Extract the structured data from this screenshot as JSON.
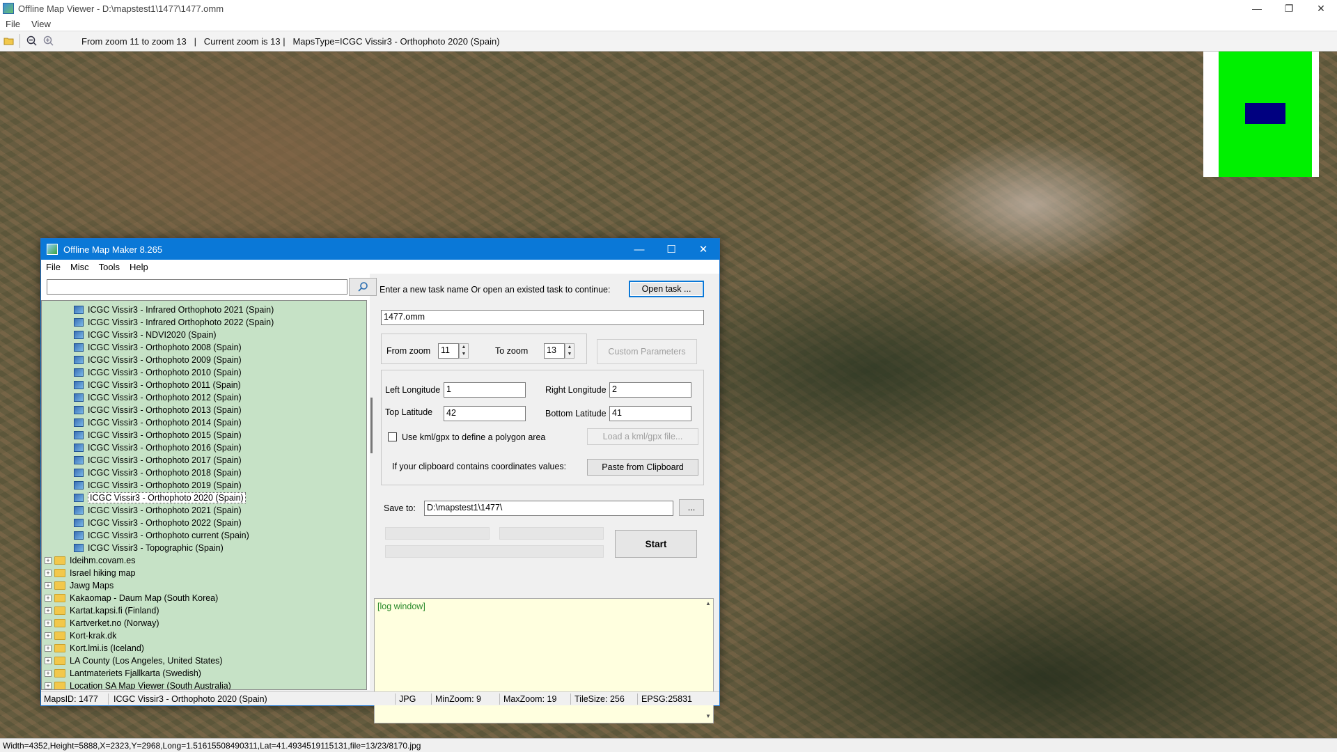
{
  "viewer": {
    "title": "Offline Map Viewer - D:\\mapstest1\\1477\\1477.omm",
    "menu": [
      "File",
      "View"
    ],
    "toolbar_info": "From zoom 11 to zoom 13   |   Current zoom is 13 |   MapsType=ICGC Vissir3 - Orthophoto 2020 (Spain)",
    "status": "Width=4352,Height=5888,X=2323,Y=2968,Long=1.51615508490311,Lat=41.4934519115131,file=13/23/8170.jpg",
    "icons": {
      "open": "folder-open-icon",
      "zoom_out": "zoom-out-icon",
      "zoom_in": "zoom-in-icon"
    }
  },
  "dialog": {
    "title": "Offline Map Maker 8.265",
    "menu": [
      "File",
      "Misc",
      "Tools",
      "Help"
    ],
    "search": {
      "value": ""
    },
    "tree": {
      "map_items": [
        "ICGC Vissir3 - Infrared Orthophoto 2021 (Spain)",
        "ICGC Vissir3 - Infrared Orthophoto 2022 (Spain)",
        "ICGC Vissir3 - NDVI2020 (Spain)",
        "ICGC Vissir3 - Orthophoto 2008 (Spain)",
        "ICGC Vissir3 - Orthophoto 2009 (Spain)",
        "ICGC Vissir3 - Orthophoto 2010 (Spain)",
        "ICGC Vissir3 - Orthophoto 2011 (Spain)",
        "ICGC Vissir3 - Orthophoto 2012 (Spain)",
        "ICGC Vissir3 - Orthophoto 2013 (Spain)",
        "ICGC Vissir3 - Orthophoto 2014 (Spain)",
        "ICGC Vissir3 - Orthophoto 2015 (Spain)",
        "ICGC Vissir3 - Orthophoto 2016 (Spain)",
        "ICGC Vissir3 - Orthophoto 2017 (Spain)",
        "ICGC Vissir3 - Orthophoto 2018 (Spain)",
        "ICGC Vissir3 - Orthophoto 2019 (Spain)",
        "ICGC Vissir3 - Orthophoto 2020 (Spain)",
        "ICGC Vissir3 - Orthophoto 2021 (Spain)",
        "ICGC Vissir3 - Orthophoto 2022 (Spain)",
        "ICGC Vissir3 - Orthophoto current (Spain)",
        "ICGC Vissir3 - Topographic (Spain)"
      ],
      "selected_index": 15,
      "folders": [
        "Ideihm.covam.es",
        "Israel hiking map",
        "Jawg Maps",
        "Kakaomap - Daum Map (South Korea)",
        "Kartat.kapsi.fi (Finland)",
        "Kartverket.no (Norway)",
        "Kort-krak.dk",
        "Kort.lmi.is (Iceland)",
        "LA County (Los Angeles, United States)",
        "Lantmateriets Fjallkarta (Swedish)",
        "Location SA Map Viewer (South Australia)"
      ]
    },
    "task": {
      "prompt": "Enter a new task name Or open an existed task to continue:",
      "open_task_label": "Open task ...",
      "task_name": "1477.omm"
    },
    "zoom": {
      "from_label": "From zoom",
      "from_value": "11",
      "to_label": "To zoom",
      "to_value": "13",
      "custom_params_label": "Custom Parameters"
    },
    "coords": {
      "left_lon_label": "Left Longitude",
      "left_lon": "1",
      "right_lon_label": "Right Longitude",
      "right_lon": "2",
      "top_lat_label": "Top Latitude",
      "top_lat": "42",
      "bottom_lat_label": "Bottom Latitude",
      "bottom_lat": "41",
      "kml_checkbox_label": "Use kml/gpx to define a polygon area",
      "load_kml_label": "Load a kml/gpx file...",
      "clipboard_label": "If your clipboard contains coordinates values:",
      "paste_label": "Paste from Clipboard"
    },
    "save": {
      "label": "Save to:",
      "path": "D:\\mapstest1\\1477\\",
      "browse_label": "...",
      "start_label": "Start"
    },
    "log": {
      "text": "[log window]"
    },
    "status": {
      "maps_id": "MapsID: 1477",
      "map_name": "ICGC Vissir3 - Orthophoto 2020 (Spain)",
      "format": "JPG",
      "min_zoom": "MinZoom: 9",
      "max_zoom": "MaxZoom: 19",
      "tile_size": "TileSize: 256",
      "epsg": "EPSG:25831"
    }
  }
}
